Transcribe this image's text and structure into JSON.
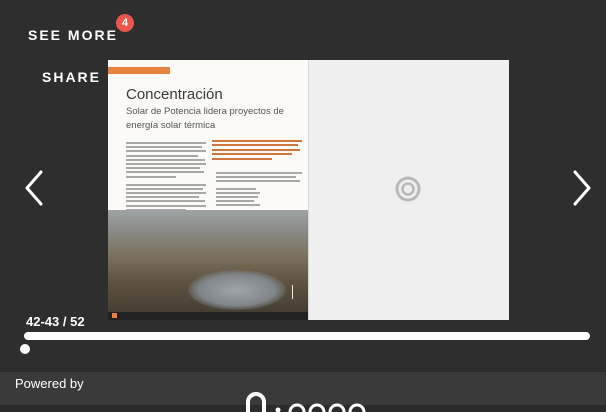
{
  "toolbar": {
    "see_more_label": "SEE MORE",
    "see_more_badge": "4",
    "share_label": "SHARE"
  },
  "navigation": {
    "prev_icon": "chevron-left-icon",
    "next_icon": "chevron-right-icon"
  },
  "spread": {
    "left_page": {
      "section_tag": "",
      "headline": "Concentración",
      "subheadline": "Solar de Potencia lidera proyectos de energía solar térmica"
    },
    "right_page": {
      "state": "loading",
      "loading_icon": "spinner-icon"
    }
  },
  "pager": {
    "label": "42-43 / 52",
    "progress": 0.0
  },
  "footer": {
    "powered_by_label": "Powered by"
  },
  "colors": {
    "background": "#2e2e2e",
    "badge": "#e8564c",
    "accent_orange": "#e8823c",
    "footer": "#3a3a3a"
  }
}
